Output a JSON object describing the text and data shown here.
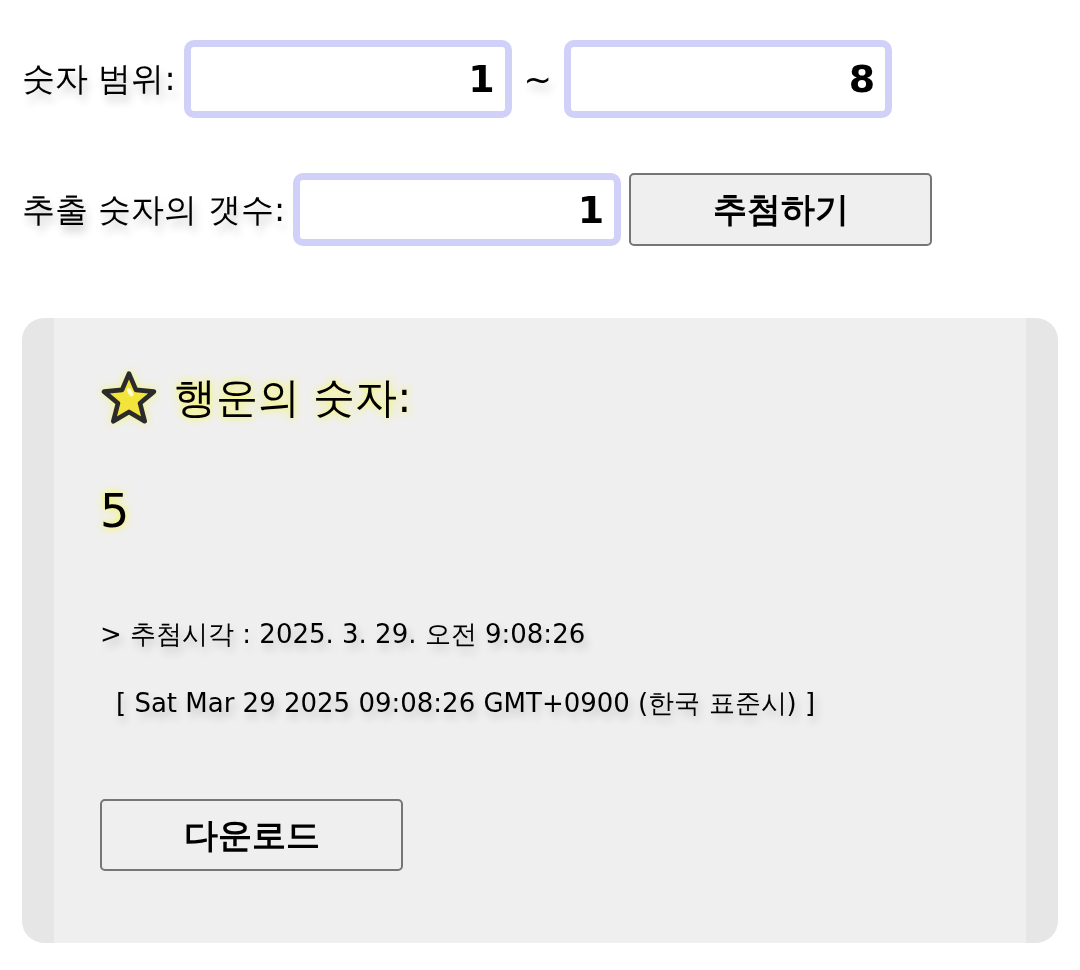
{
  "range": {
    "label": "숫자 범위:",
    "from": "1",
    "separator": "~",
    "to": "8"
  },
  "count": {
    "label": "추출 숫자의 갯수:",
    "value": "1"
  },
  "draw_button": "추첨하기",
  "result": {
    "heading": "행운의 숫자:",
    "number": "5",
    "draw_time": "> 추첨시각 : 2025. 3. 29. 오전 9:08:26",
    "raw_time": "[ Sat Mar 29 2025 09:08:26 GMT+0900 (한국 표준시) ]",
    "download_button": "다운로드"
  }
}
